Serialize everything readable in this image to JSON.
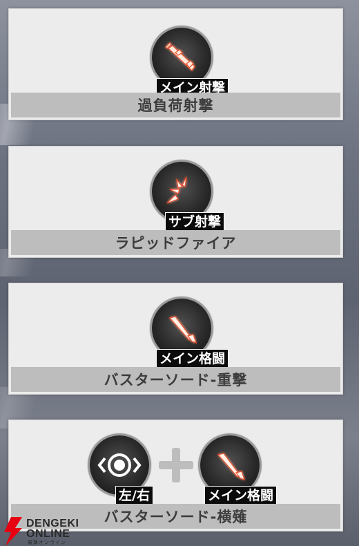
{
  "colors": {
    "card_bg": "#ececec",
    "label_bar_bg": "#bdbdbd",
    "label_text": "#3d3d3d",
    "tag_bg": "#0b0b0b",
    "tag_text": "#ffffff",
    "icon_glow": "#e8502a",
    "logo_red": "#e60012"
  },
  "skills": [
    {
      "name": "過負荷射撃",
      "icons": [
        {
          "icon": "rifle-icon",
          "tag": "メイン射撃"
        }
      ]
    },
    {
      "name": "ラピッドファイア",
      "icons": [
        {
          "icon": "burst-fire-icon",
          "tag": "サブ射撃"
        }
      ]
    },
    {
      "name": "バスターソード-重撃",
      "icons": [
        {
          "icon": "sword-icon",
          "tag": "メイン格闘"
        }
      ]
    },
    {
      "name": "バスターソード-横薙",
      "icons": [
        {
          "icon": "dodge-left-right-icon",
          "tag": "左/右"
        },
        {
          "icon": "sword-icon",
          "tag": "メイン格闘"
        }
      ],
      "combinator": "plus-icon"
    }
  ],
  "watermark": {
    "line1": "DENGEKI",
    "line2": "ONLINE",
    "line3": "電撃オンライン"
  }
}
